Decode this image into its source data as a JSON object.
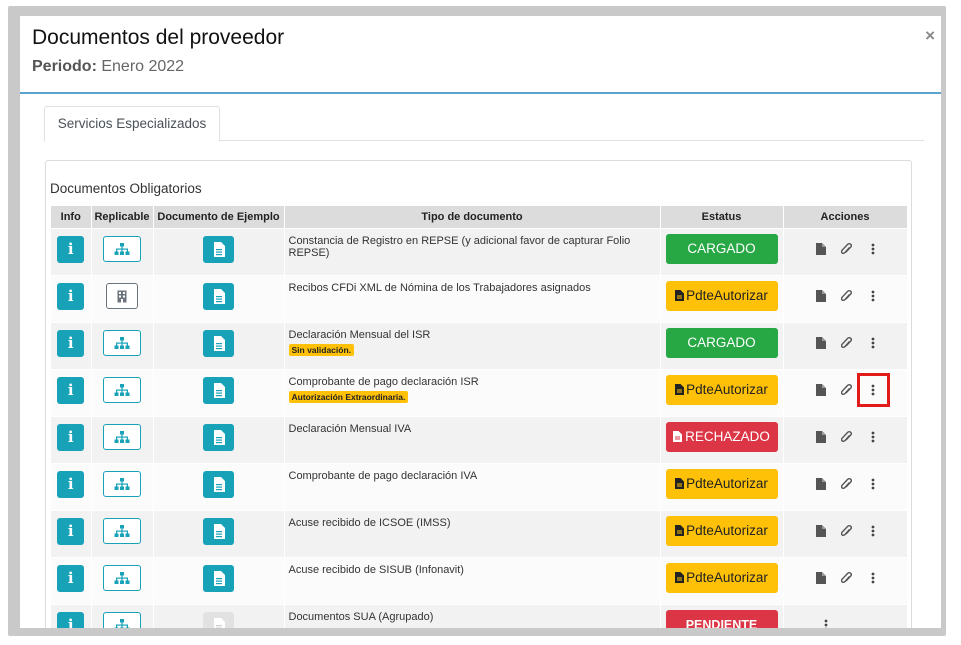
{
  "modal": {
    "title": "Documentos del proveedor",
    "period_label": "Periodo:",
    "period_value": "Enero 2022",
    "close_glyph": "×"
  },
  "tabs": [
    {
      "label": "Servicios Especializados",
      "active": true
    }
  ],
  "card": {
    "title": "Documentos Obligatorios"
  },
  "table": {
    "headers": [
      "Info",
      "Replicable",
      "Documento de Ejemplo",
      "Tipo de documento",
      "Estatus",
      "Acciones"
    ],
    "rows": [
      {
        "type": "Constancia de Registro en REPSE (y adicional favor de capturar Folio REPSE)",
        "badge": "",
        "status": "CARGADO",
        "status_kind": "green",
        "replicable_icon": "sitemap-icon",
        "example_enabled": true,
        "actions": [
          "file-icon",
          "paperclip-icon",
          "more-vertical-icon"
        ]
      },
      {
        "type": "Recibos CFDi XML de Nómina de los Trabajadores asignados",
        "badge": "",
        "status": "PdteAutorizar",
        "status_kind": "yellow",
        "replicable_icon": "building-icon",
        "example_enabled": true,
        "actions": [
          "file-icon",
          "paperclip-icon",
          "more-vertical-icon"
        ]
      },
      {
        "type": "Declaración Mensual del ISR",
        "badge": "Sin validación.",
        "status": "CARGADO",
        "status_kind": "green",
        "replicable_icon": "sitemap-icon",
        "example_enabled": true,
        "actions": [
          "file-icon",
          "paperclip-icon",
          "more-vertical-icon"
        ]
      },
      {
        "type": "Comprobante de pago declaración ISR",
        "badge": "Autorización Extraordinaria.",
        "status": "PdteAutorizar",
        "status_kind": "yellow",
        "replicable_icon": "sitemap-icon",
        "example_enabled": true,
        "actions": [
          "file-icon",
          "paperclip-icon",
          "more-vertical-icon"
        ]
      },
      {
        "type": "Declaración Mensual IVA",
        "badge": "",
        "status": "RECHAZADO",
        "status_kind": "red",
        "replicable_icon": "sitemap-icon",
        "example_enabled": true,
        "actions": [
          "file-icon",
          "paperclip-icon",
          "more-vertical-icon"
        ]
      },
      {
        "type": "Comprobante de pago declaración IVA",
        "badge": "",
        "status": "PdteAutorizar",
        "status_kind": "yellow",
        "replicable_icon": "sitemap-icon",
        "example_enabled": true,
        "actions": [
          "file-icon",
          "paperclip-icon",
          "more-vertical-icon"
        ]
      },
      {
        "type": "Acuse recibido de ICSOE (IMSS)",
        "badge": "",
        "status": "PdteAutorizar",
        "status_kind": "yellow",
        "replicable_icon": "sitemap-icon",
        "example_enabled": true,
        "actions": [
          "file-icon",
          "paperclip-icon",
          "more-vertical-icon"
        ]
      },
      {
        "type": "Acuse recibido de SISUB (Infonavit)",
        "badge": "",
        "status": "PdteAutorizar",
        "status_kind": "yellow",
        "replicable_icon": "sitemap-icon",
        "example_enabled": true,
        "actions": [
          "file-icon",
          "paperclip-icon",
          "more-vertical-icon"
        ]
      },
      {
        "type": "Documentos SUA (Agrupado)",
        "badge": "",
        "status": "PENDIENTE",
        "status_kind": "pend",
        "replicable_icon": "sitemap-icon",
        "example_enabled": false,
        "actions": [
          "more-vertical-icon"
        ]
      }
    ]
  },
  "colors": {
    "info": "#17a2b8",
    "success": "#28a745",
    "warning": "#ffc107",
    "danger": "#dc3545",
    "highlight": "#e11a1a"
  },
  "highlight": {
    "row": 3,
    "action": "more-vertical-icon"
  }
}
